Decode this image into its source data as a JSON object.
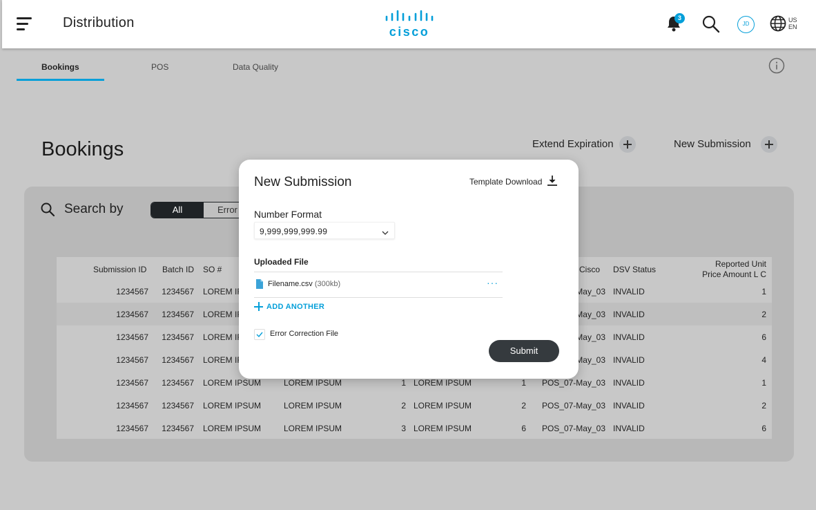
{
  "header": {
    "app_title": "Distribution",
    "logo_text": "cisco",
    "notification_count": "3",
    "avatar_initials": "JD",
    "locale_country": "US",
    "locale_language": "EN"
  },
  "tabs": [
    {
      "label": "Bookings",
      "active": true
    },
    {
      "label": "POS",
      "active": false
    },
    {
      "label": "Data Quality",
      "active": false
    }
  ],
  "page": {
    "title": "Bookings",
    "actions": {
      "extend_label": "Extend Expiration",
      "new_label": "New Submission"
    }
  },
  "search": {
    "label": "Search by",
    "segments": [
      "All",
      "Error"
    ]
  },
  "table": {
    "headers": [
      "Submission ID",
      "Batch ID",
      "SO #",
      "o Cisco",
      "DSV Status",
      "Reported Unit",
      "Price Amount L C"
    ],
    "rows": [
      {
        "submission_id": "1234567",
        "batch_id": "1234567",
        "so": "LOREM IF",
        "c1": "",
        "n1": "",
        "c2": "",
        "n2": "",
        "cisco": "May_03",
        "status": "INVALID",
        "amount": "1"
      },
      {
        "submission_id": "1234567",
        "batch_id": "1234567",
        "so": "LOREM IF",
        "c1": "",
        "n1": "",
        "c2": "",
        "n2": "",
        "cisco": "May_03",
        "status": "INVALID",
        "amount": "2"
      },
      {
        "submission_id": "1234567",
        "batch_id": "1234567",
        "so": "LOREM IF",
        "c1": "",
        "n1": "",
        "c2": "",
        "n2": "",
        "cisco": "May_03",
        "status": "INVALID",
        "amount": "6"
      },
      {
        "submission_id": "1234567",
        "batch_id": "1234567",
        "so": "LOREM IF",
        "c1": "",
        "n1": "",
        "c2": "",
        "n2": "",
        "cisco": "May_03",
        "status": "INVALID",
        "amount": "4"
      },
      {
        "submission_id": "1234567",
        "batch_id": "1234567",
        "so": "LOREM IPSUM",
        "c1": "LOREM IPSUM",
        "n1": "1",
        "c2": "LOREM IPSUM",
        "n2": "1",
        "cisco": "POS_07-May_03",
        "status": "INVALID",
        "amount": "1"
      },
      {
        "submission_id": "1234567",
        "batch_id": "1234567",
        "so": "LOREM IPSUM",
        "c1": "LOREM IPSUM",
        "n1": "2",
        "c2": "LOREM IPSUM",
        "n2": "2",
        "cisco": "POS_07-May_03",
        "status": "INVALID",
        "amount": "2"
      },
      {
        "submission_id": "1234567",
        "batch_id": "1234567",
        "so": "LOREM IPSUM",
        "c1": "LOREM IPSUM",
        "n1": "3",
        "c2": "LOREM IPSUM",
        "n2": "6",
        "cisco": "POS_07-May_03",
        "status": "INVALID",
        "amount": "6"
      }
    ]
  },
  "modal": {
    "title": "New Submission",
    "template_download": "Template Download",
    "number_format_label": "Number Format",
    "number_format_value": "9,999,999,999.99",
    "uploaded_file_label": "Uploaded File",
    "file_name": "Filename.csv",
    "file_size": "(300kb)",
    "more_label": "···",
    "add_another": "ADD ANOTHER",
    "error_correction_label": "Error Correction File",
    "error_correction_checked": true,
    "submit": "Submit"
  },
  "colors": {
    "accent": "#049fd9",
    "dark": "#1f2326",
    "overlay_bg": "#c8c8c8",
    "panel_bg": "#b8b8b8"
  },
  "icons": [
    "menu-icon",
    "cisco-logo",
    "bell-icon",
    "search-icon",
    "avatar",
    "globe-icon",
    "info-icon",
    "plus-icon",
    "download-icon",
    "file-icon",
    "chevron-down-icon",
    "checkmark-icon"
  ]
}
